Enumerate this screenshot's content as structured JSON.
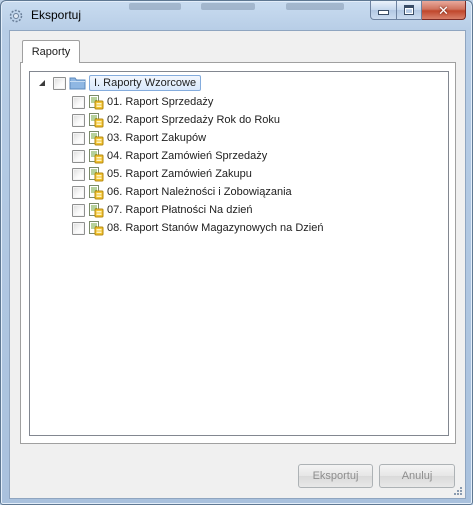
{
  "window": {
    "title": "Eksportuj"
  },
  "tab": {
    "label": "Raporty"
  },
  "tree": {
    "root_label": "I. Raporty Wzorcowe",
    "items": [
      {
        "label": "01. Raport Sprzedaży"
      },
      {
        "label": "02. Raport Sprzedaży Rok do Roku"
      },
      {
        "label": "03. Raport Zakupów"
      },
      {
        "label": "04. Raport Zamówień Sprzedaży"
      },
      {
        "label": "05. Raport Zamówień Zakupu"
      },
      {
        "label": "06. Raport Należności i Zobowiązania"
      },
      {
        "label": "07. Raport Płatności Na dzień"
      },
      {
        "label": "08. Raport Stanów Magazynowych na Dzień"
      }
    ]
  },
  "buttons": {
    "export_label": "Eksportuj",
    "cancel_label": "Anuluj"
  },
  "icons": {
    "app": "gear-icon",
    "folder": "folder-icon",
    "report": "report-icon",
    "close": "close-icon"
  },
  "colors": {
    "title_bar": "#b9cfe8",
    "close_button": "#c4472c",
    "selection_border": "#84acdd",
    "disabled_text": "#8d8d8d"
  }
}
